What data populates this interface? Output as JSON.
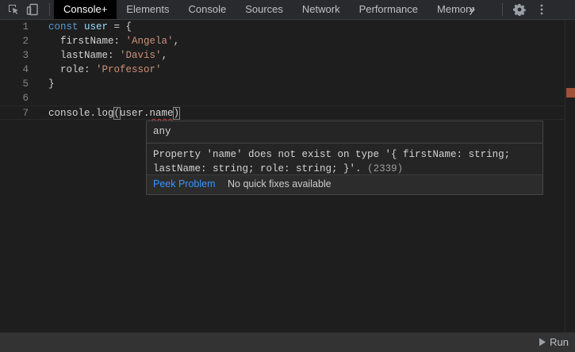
{
  "tabs": [
    {
      "label": "Console+",
      "active": true
    },
    {
      "label": "Elements"
    },
    {
      "label": "Console"
    },
    {
      "label": "Sources"
    },
    {
      "label": "Network"
    },
    {
      "label": "Performance"
    },
    {
      "label": "Memory"
    }
  ],
  "toolbar": {
    "more_tabs": "»",
    "icons": [
      "inspect-element-icon",
      "device-toolbar-icon",
      "gear-icon",
      "more-vertical-icon"
    ]
  },
  "code": {
    "line_numbers": [
      "1",
      "2",
      "3",
      "4",
      "5",
      "6",
      "7"
    ],
    "l1_kw": "const",
    "l1_var": "user",
    "l1_rest": " = {",
    "l2_prop": "firstName",
    "l2_val": "'Angela'",
    "l3_prop": "lastName",
    "l3_val": "'Davis'",
    "l4_prop": "role",
    "l4_val": "'Professor'",
    "l5": "}",
    "l7_pre": "console.log",
    "l7_open": "(",
    "l7_obj": "user.",
    "l7_err": "name",
    "l7_close": ")"
  },
  "hover": {
    "type": "any",
    "message": "Property 'name' does not exist on type '{ firstName: string; lastName: string; role: string; }'.",
    "code": "(2339)",
    "peek_label": "Peek Problem",
    "no_fix_label": "No quick fixes available"
  },
  "bottom": {
    "run_label": "Run"
  },
  "colors": {
    "keyword": "#569cd6",
    "string": "#ce9178",
    "error": "#d83b3b",
    "link": "#3794ff"
  }
}
